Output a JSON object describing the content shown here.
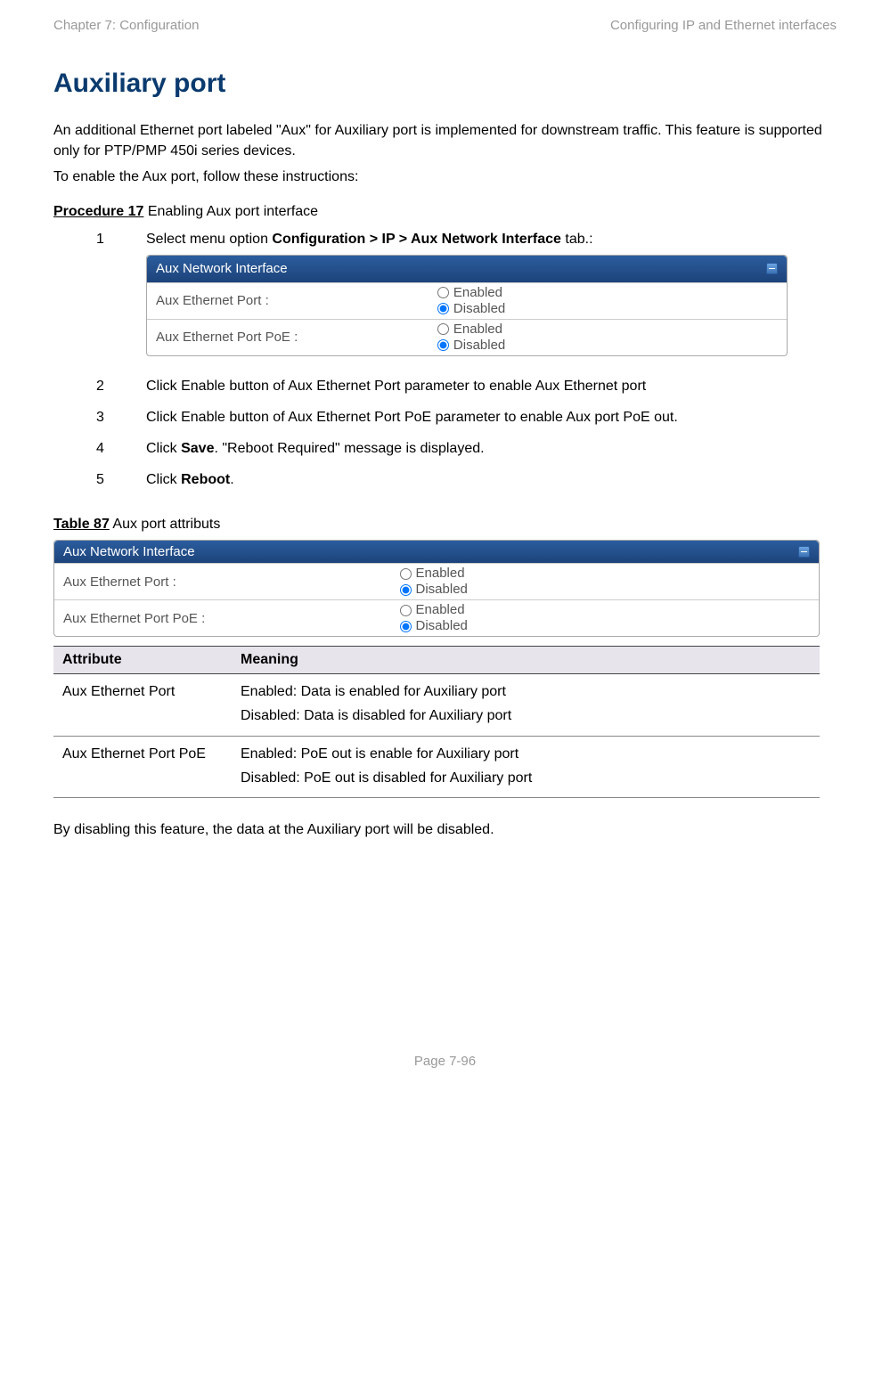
{
  "header": {
    "left": "Chapter 7:  Configuration",
    "right": "Configuring IP and Ethernet interfaces"
  },
  "title": "Auxiliary port",
  "intro1": "An additional Ethernet port labeled \"Aux\" for Auxiliary port is implemented for downstream traffic. This feature is supported only for PTP/PMP 450i series devices.",
  "intro2": "To enable the Aux port, follow these instructions:",
  "procedure": {
    "label": "Procedure 17",
    "title": " Enabling Aux port interface",
    "steps": [
      {
        "num": "1",
        "pre": "Select menu option ",
        "bold": "Configuration > IP > Aux Network Interface",
        "post": " tab.:"
      },
      {
        "num": "2",
        "text": "Click Enable button of Aux Ethernet Port parameter to enable Aux Ethernet port"
      },
      {
        "num": "3",
        "text": "Click Enable button of Aux Ethernet Port PoE parameter to enable Aux port PoE out."
      },
      {
        "num": "4",
        "pre": "Click ",
        "bold": "Save",
        "post": ". \"Reboot Required\" message is displayed."
      },
      {
        "num": "5",
        "pre": "Click ",
        "bold": "Reboot",
        "post": "."
      }
    ]
  },
  "panel": {
    "title": "Aux Network Interface",
    "rows": [
      {
        "label": "Aux Ethernet Port :",
        "enabled": "Enabled",
        "disabled": "Disabled",
        "selected": "disabled"
      },
      {
        "label": "Aux Ethernet Port PoE :",
        "enabled": "Enabled",
        "disabled": "Disabled",
        "selected": "disabled"
      }
    ]
  },
  "table_caption": {
    "label": "Table 87",
    "title": " Aux port attributs"
  },
  "attr_table": {
    "headers": {
      "attr": "Attribute",
      "meaning": "Meaning"
    },
    "rows": [
      {
        "attr": "Aux Ethernet Port",
        "enabled_line": "Enabled: Data is enabled for Auxiliary port",
        "disabled_line": "Disabled: Data is disabled for Auxiliary port"
      },
      {
        "attr": "Aux Ethernet Port PoE",
        "enabled_line": "Enabled: PoE out is enable for Auxiliary port",
        "disabled_line": "Disabled: PoE out is disabled for Auxiliary port"
      }
    ]
  },
  "closing": "By disabling this feature, the data at the Auxiliary port will be disabled.",
  "footer": "Page 7-96"
}
